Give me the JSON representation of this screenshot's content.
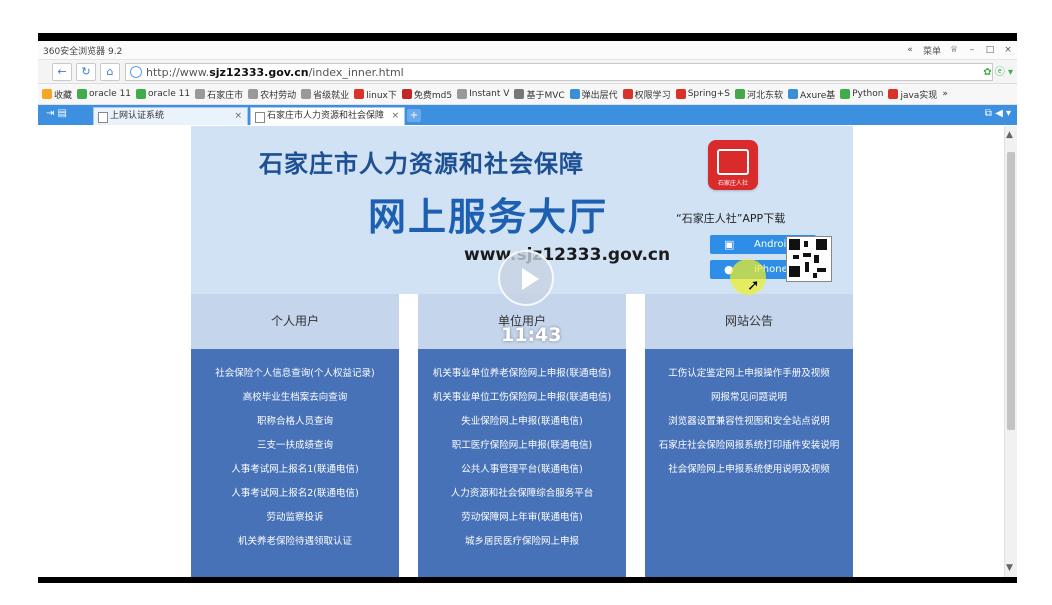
{
  "browser": {
    "app_title": "360安全浏览器 9.2",
    "window_menu": "菜单",
    "url_plain": "http://www.",
    "url_domain": "sjz12333.gov.cn",
    "url_path": "/index_inner.html",
    "bookmarks": [
      {
        "label": "收藏",
        "color": "#f5a623"
      },
      {
        "label": "oracle 11",
        "color": "#3fae4a"
      },
      {
        "label": "oracle 11",
        "color": "#3fae4a"
      },
      {
        "label": "石家庄市",
        "color": "#999999"
      },
      {
        "label": "农村劳动",
        "color": "#999999"
      },
      {
        "label": "省级就业",
        "color": "#999999"
      },
      {
        "label": "linux下",
        "color": "#d9322b"
      },
      {
        "label": "免费md5",
        "color": "#c0262a"
      },
      {
        "label": "Instant V",
        "color": "#999999"
      },
      {
        "label": "基于MVC",
        "color": "#777777"
      },
      {
        "label": "弹出层代",
        "color": "#3b8fd9"
      },
      {
        "label": "权限学习",
        "color": "#d9322b"
      },
      {
        "label": "Spring+S",
        "color": "#d9322b"
      },
      {
        "label": "河北东软",
        "color": "#45a84a"
      },
      {
        "label": "Axure基",
        "color": "#3b8fd9"
      },
      {
        "label": "Python",
        "color": "#3fae4a"
      },
      {
        "label": "java实现",
        "color": "#d9322b"
      }
    ],
    "bookmarks_more": "»",
    "tabs": [
      {
        "label": "上网认证系统"
      },
      {
        "label": "石家庄市人力资源和社会保障"
      }
    ],
    "new_tab": "+"
  },
  "banner": {
    "title1": "石家庄市人力资源和社会保障",
    "title2": "网上服务大厅",
    "url": "www.sjz12333.gov.cn",
    "app_logo_text": "石家庄人社",
    "app_download": "“石家庄人社”APP下载",
    "android_label": "Android",
    "iphone_label": "iPhone"
  },
  "video": {
    "time": "11:43"
  },
  "columns": [
    {
      "head": "个人用户",
      "items": [
        "社会保险个人信息查询(个人权益记录)",
        "高校毕业生档案去向查询",
        "职称合格人员查询",
        "三支一扶成绩查询",
        "人事考试网上报名1(联通电信)",
        "人事考试网上报名2(联通电信)",
        "劳动监察投诉",
        "机关养老保险待遇领取认证"
      ]
    },
    {
      "head": "单位用户",
      "items": [
        "机关事业单位养老保险网上申报(联通电信)",
        "机关事业单位工伤保险网上申报(联通电信)",
        "失业保险网上申报(联通电信)",
        "职工医疗保险网上申报(联通电信)",
        "公共人事管理平台(联通电信)",
        "人力资源和社会保障综合服务平台",
        "劳动保障网上年审(联通电信)",
        "城乡居民医疗保险网上申报"
      ]
    },
    {
      "head": "网站公告",
      "items": [
        "工伤认定鉴定网上申报操作手册及视频",
        "网报常见问题说明",
        "浏览器设置兼容性视图和安全站点说明",
        "石家庄社会保险网报系统打印插件安装说明",
        "社会保险网上申报系统使用说明及视频"
      ]
    }
  ]
}
